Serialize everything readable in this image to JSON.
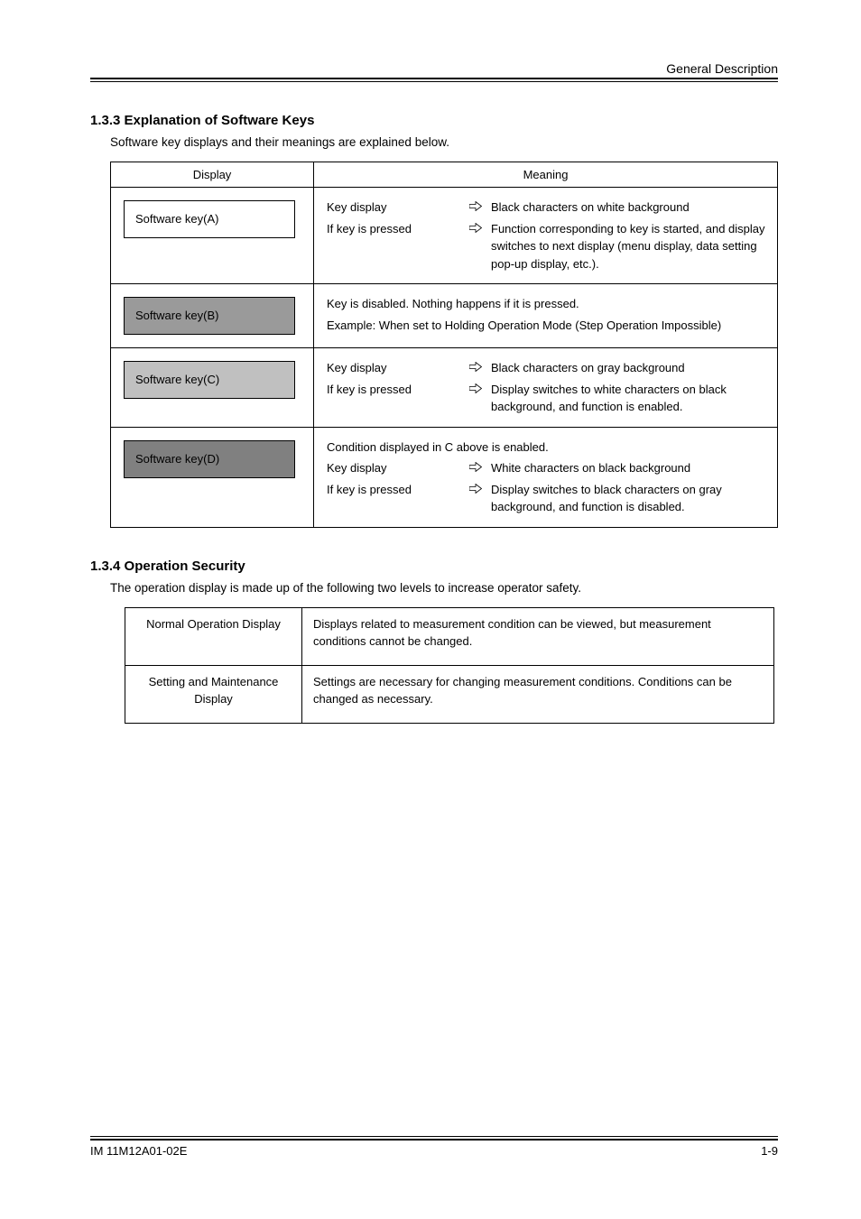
{
  "header": {
    "right": "General Description"
  },
  "section1": {
    "title": "1.3.3 Explanation of Software Keys",
    "lead": "Software key displays and their meanings are explained below.",
    "table_head": {
      "disp": "Display",
      "meaning": "Meaning"
    },
    "rows": [
      {
        "swatch_text": "Software key(A)",
        "swatch_class": "white",
        "lines": [
          {
            "left": "Key display",
            "arrow": true,
            "right": "Black characters on white background"
          },
          {
            "left": "If key is pressed",
            "arrow": true,
            "right": "Function corresponding to key is started, and display switches to next display (menu display, data setting pop-up display, etc.)."
          }
        ]
      },
      {
        "swatch_text": "Software key(B)",
        "swatch_class": "darkgray",
        "plain": [
          "Key is disabled. Nothing happens if it is pressed.",
          "Example: When set to Holding Operation Mode (Step Operation Impossible)"
        ]
      },
      {
        "swatch_text": "Software key(C)",
        "swatch_class": "lightgray",
        "lines": [
          {
            "left": "Key display",
            "arrow": true,
            "right": "Black characters on gray background"
          },
          {
            "left": "If key is pressed",
            "arrow": true,
            "right": "Display switches to white characters on black background, and function is enabled."
          }
        ]
      },
      {
        "swatch_text": "Software key(D)",
        "swatch_class": "midgray",
        "plain_first": "Condition displayed in C above is enabled.",
        "lines": [
          {
            "left": "Key display",
            "arrow": true,
            "right": "White characters on black background"
          },
          {
            "left": "If key is pressed",
            "arrow": true,
            "right": "Display switches to black characters on gray background, and function is disabled."
          }
        ]
      }
    ]
  },
  "section2": {
    "title": "1.3.4 Operation Security",
    "lead": "The operation display is made up of the following two levels to increase operator safety.",
    "rows": [
      {
        "left": "Normal Operation Display",
        "right": "Displays related to measurement condition can be viewed, but measurement conditions cannot be changed."
      },
      {
        "left": "Setting and Maintenance Display",
        "right": "Settings are necessary for changing measurement conditions. Conditions can be changed as necessary."
      }
    ]
  },
  "footer": {
    "product": "IM 11M12A01-02E",
    "page": "1-9"
  }
}
